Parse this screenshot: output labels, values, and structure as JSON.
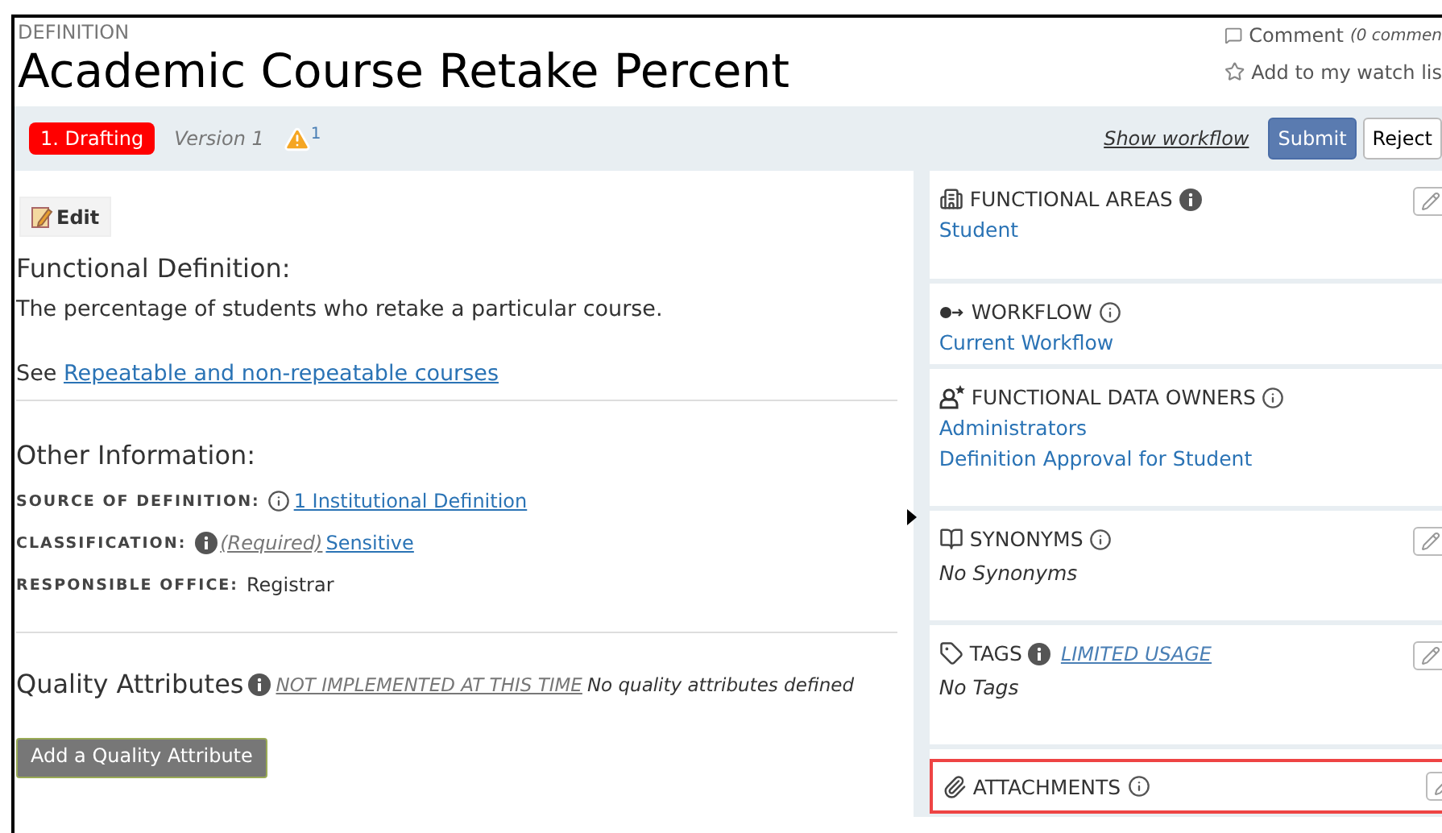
{
  "header": {
    "label": "DEFINITION",
    "title": "Academic Course Retake Percent"
  },
  "actions": [
    {
      "kind": "comment",
      "label": "Comment",
      "note": "(0 commen"
    },
    {
      "kind": "watch",
      "label": "Add to my watch lis"
    }
  ],
  "status_bar": {
    "stage": "1. Drafting",
    "version": "Version 1",
    "warnings": "1",
    "workflow_link": "Show workflow",
    "buttons": [
      {
        "label": "Submit",
        "primary": true
      },
      {
        "label": "Reject",
        "primary": false
      }
    ]
  },
  "edit_button": "Edit",
  "functional_definition": {
    "heading": "Functional Definition:",
    "text": "The percentage of students who retake a particular course.",
    "see": "See",
    "link": "Repeatable and non-repeatable courses"
  },
  "other_information": {
    "heading": "Other Information:",
    "fields": [
      {
        "label": "SOURCE OF DEFINITION:",
        "value": "1 Institutional Definition",
        "link": true
      },
      {
        "label": "CLASSIFICATION:",
        "note": "(Required)",
        "value": "Sensitive",
        "link": true
      },
      {
        "label": "RESPONSIBLE OFFICE:",
        "value": "Registrar",
        "link": false
      }
    ]
  },
  "quality_attributes": {
    "heading": "Quality Attributes",
    "note": "NOT IMPLEMENTED AT THIS TIME",
    "empty": "No quality attributes defined",
    "button": "Add a Quality Attribute"
  },
  "panels": [
    {
      "title": "FUNCTIONAL AREAS",
      "items": [
        "Student"
      ],
      "editable": true,
      "highlighted": false
    },
    {
      "title": "WORKFLOW",
      "items": [
        "Current Workflow"
      ],
      "editable": false,
      "highlighted": false
    },
    {
      "title": "FUNCTIONAL DATA OWNERS",
      "items": [
        "Administrators",
        "Definition Approval for Student"
      ],
      "editable": false,
      "highlighted": false
    },
    {
      "title": "SYNONYMS",
      "empty": "No Synonyms",
      "editable": true,
      "highlighted": false
    },
    {
      "title": "TAGS",
      "extra": "LIMITED USAGE",
      "empty": "No Tags",
      "editable": true,
      "highlighted": false
    },
    {
      "title": "ATTACHMENTS",
      "editable": true,
      "highlighted": true
    }
  ]
}
